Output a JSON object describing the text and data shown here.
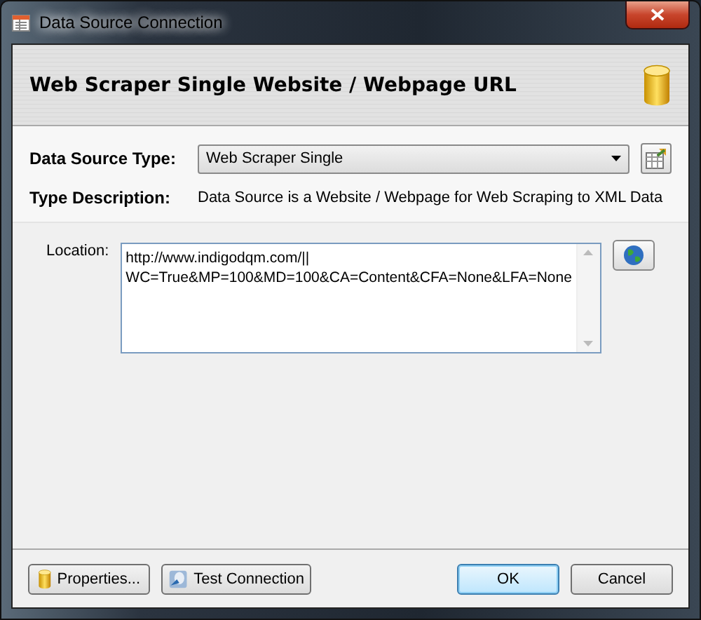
{
  "window": {
    "title": "Data Source Connection"
  },
  "header": {
    "title": "Web Scraper Single Website / Webpage URL"
  },
  "data_source_type": {
    "label": "Data Source Type:",
    "value": "Web Scraper Single"
  },
  "type_description": {
    "label": "Type Description:",
    "value": "Data Source is a Website / Webpage for Web Scraping to XML Data"
  },
  "location": {
    "label": "Location:",
    "value": "http://www.indigodqm.com/||\nWC=True&MP=100&MD=100&CA=Content&CFA=None&LFA=None"
  },
  "buttons": [
    {
      "label": "Properties...",
      "kind": "properties"
    },
    {
      "label": "Test Connection",
      "kind": "test"
    },
    {
      "label": "OK",
      "kind": "default"
    },
    {
      "label": "Cancel",
      "kind": "plain"
    }
  ]
}
